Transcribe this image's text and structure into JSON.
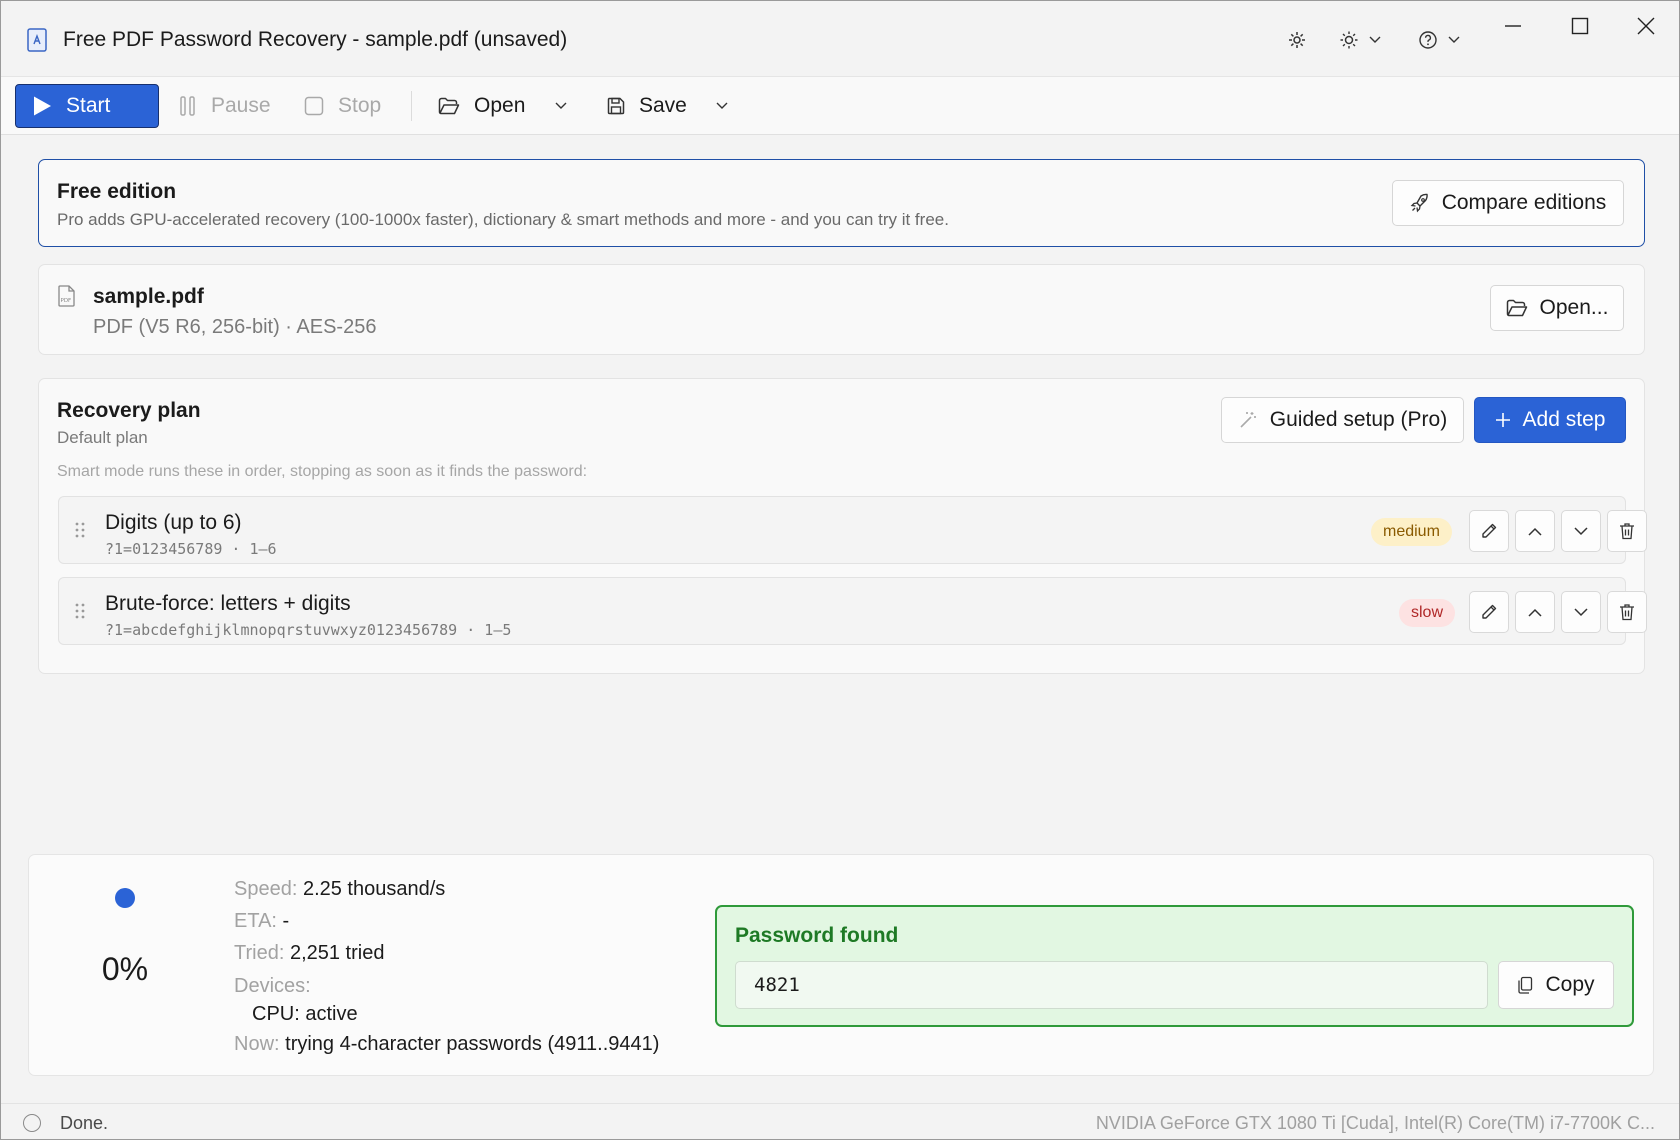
{
  "window": {
    "title": "Free PDF Password Recovery - sample.pdf (unsaved)"
  },
  "toolbar": {
    "start_label": "Start",
    "pause_label": "Pause",
    "stop_label": "Stop",
    "open_label": "Open",
    "save_label": "Save"
  },
  "promo": {
    "title": "Free edition",
    "subtitle": "Pro adds GPU-accelerated recovery (100-1000x faster), dictionary & smart methods and more - and you can try it free.",
    "compare_label": "Compare editions"
  },
  "file": {
    "name": "sample.pdf",
    "info": "PDF (V5 R6, 256-bit) · AES-256",
    "open_label": "Open..."
  },
  "plan": {
    "title": "Recovery plan",
    "subtitle": "Default plan",
    "guided_label": "Guided setup (Pro)",
    "add_step_label": "Add step",
    "note": "Smart mode runs these in order, stopping as soon as it finds the password:",
    "steps": [
      {
        "name": "Digits (up to 6)",
        "desc": "?1=0123456789 · 1–6",
        "speed": "medium"
      },
      {
        "name": "Brute-force: letters + digits",
        "desc": "?1=abcdefghijklmnopqrstuvwxyz0123456789 · 1–5",
        "speed": "slow"
      }
    ]
  },
  "status": {
    "percent": "0%",
    "progress_fraction": 0,
    "speed_label": "Speed:",
    "speed_value": "2.25 thousand/s",
    "eta_label": "ETA:",
    "eta_value": "-",
    "tried_label": "Tried:",
    "tried_value": "2,251 tried",
    "devices_label": "Devices:",
    "device_cpu": "CPU: active",
    "now_label": "Now:",
    "now_value": "trying 4-character passwords  (4911..9441)"
  },
  "found": {
    "title": "Password found",
    "password": "4821",
    "copy_label": "Copy"
  },
  "statusbar": {
    "text": "Done.",
    "devices": "NVIDIA GeForce GTX 1080 Ti [Cuda], Intel(R) Core(TM) i7-7700K C..."
  },
  "colors": {
    "accent": "#2b63d6",
    "success": "#2f9a3a",
    "medium_badge": "#fdf0c8",
    "slow_badge": "#fde2e2"
  }
}
